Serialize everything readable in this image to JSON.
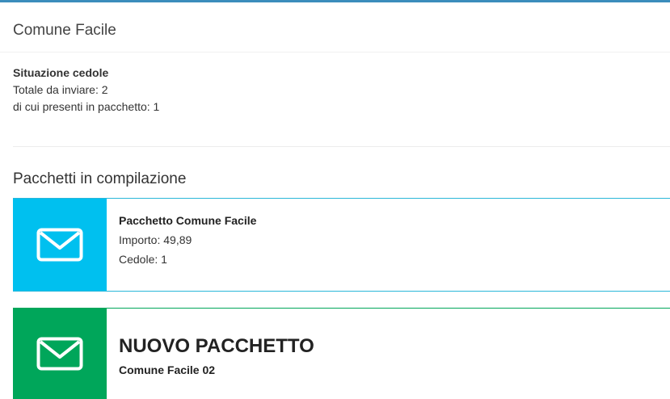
{
  "header": {
    "title": "Comune Facile"
  },
  "situazione": {
    "heading": "Situazione cedole",
    "totale": "Totale da inviare: 2",
    "presenti": "di cui presenti in pacchetto: 1"
  },
  "section": {
    "title": "Pacchetti in compilazione"
  },
  "packages": [
    {
      "name": "Pacchetto Comune Facile",
      "importo": "Importo: 49,89",
      "cedole": "Cedole: 1",
      "icon": "envelope-icon",
      "color": "#00c0ef"
    }
  ],
  "new_package": {
    "title": "NUOVO PACCHETTO",
    "subtitle": "Comune Facile 02",
    "icon": "envelope-icon",
    "color": "#00a65a"
  },
  "colors": {
    "accent": "#3c8dbc",
    "info": "#00c0ef",
    "success": "#00a65a"
  }
}
